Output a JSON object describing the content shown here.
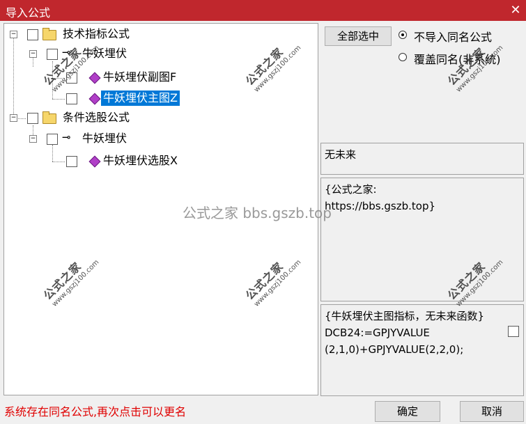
{
  "window": {
    "title": "导入公式",
    "close_glyph": "✕"
  },
  "tree": {
    "groups": [
      {
        "label": "技术指标公式",
        "item": "牛妖埋伏",
        "children": [
          "牛妖埋伏副图F",
          "牛妖埋伏主图Z"
        ]
      },
      {
        "label": "条件选股公式",
        "item": "牛妖埋伏",
        "children": [
          "牛妖埋伏选股X"
        ]
      }
    ],
    "selected": "牛妖埋伏主图Z"
  },
  "right": {
    "select_all_label": "全部选中",
    "radio_options": [
      "不导入同名公式",
      "覆盖同名(非系统)"
    ],
    "selected_radio": 0,
    "future_text": "无未来",
    "note_text": "{公式之家:\nhttps://bbs.gszb.top}",
    "code_text": "{牛妖埋伏主图指标，无未来函数}\nDCB24:=GPJYVALUE\n(2,1,0)+GPJYVALUE(2,2,0);"
  },
  "status_text": "系统存在同名公式,再次点击可以更名",
  "buttons": {
    "ok": "确定",
    "cancel": "取消"
  },
  "watermark": {
    "main": "公式之家",
    "sub": "www.gszj100.com",
    "center": "公式之家 bbs.gszb.top"
  },
  "icons": {
    "folder": "folder-icon",
    "key": "key-icon",
    "formula": "formula-gem-icon"
  },
  "colors": {
    "titlebar": "#c0272d",
    "selection": "#0078d7",
    "status": "#e00000"
  }
}
